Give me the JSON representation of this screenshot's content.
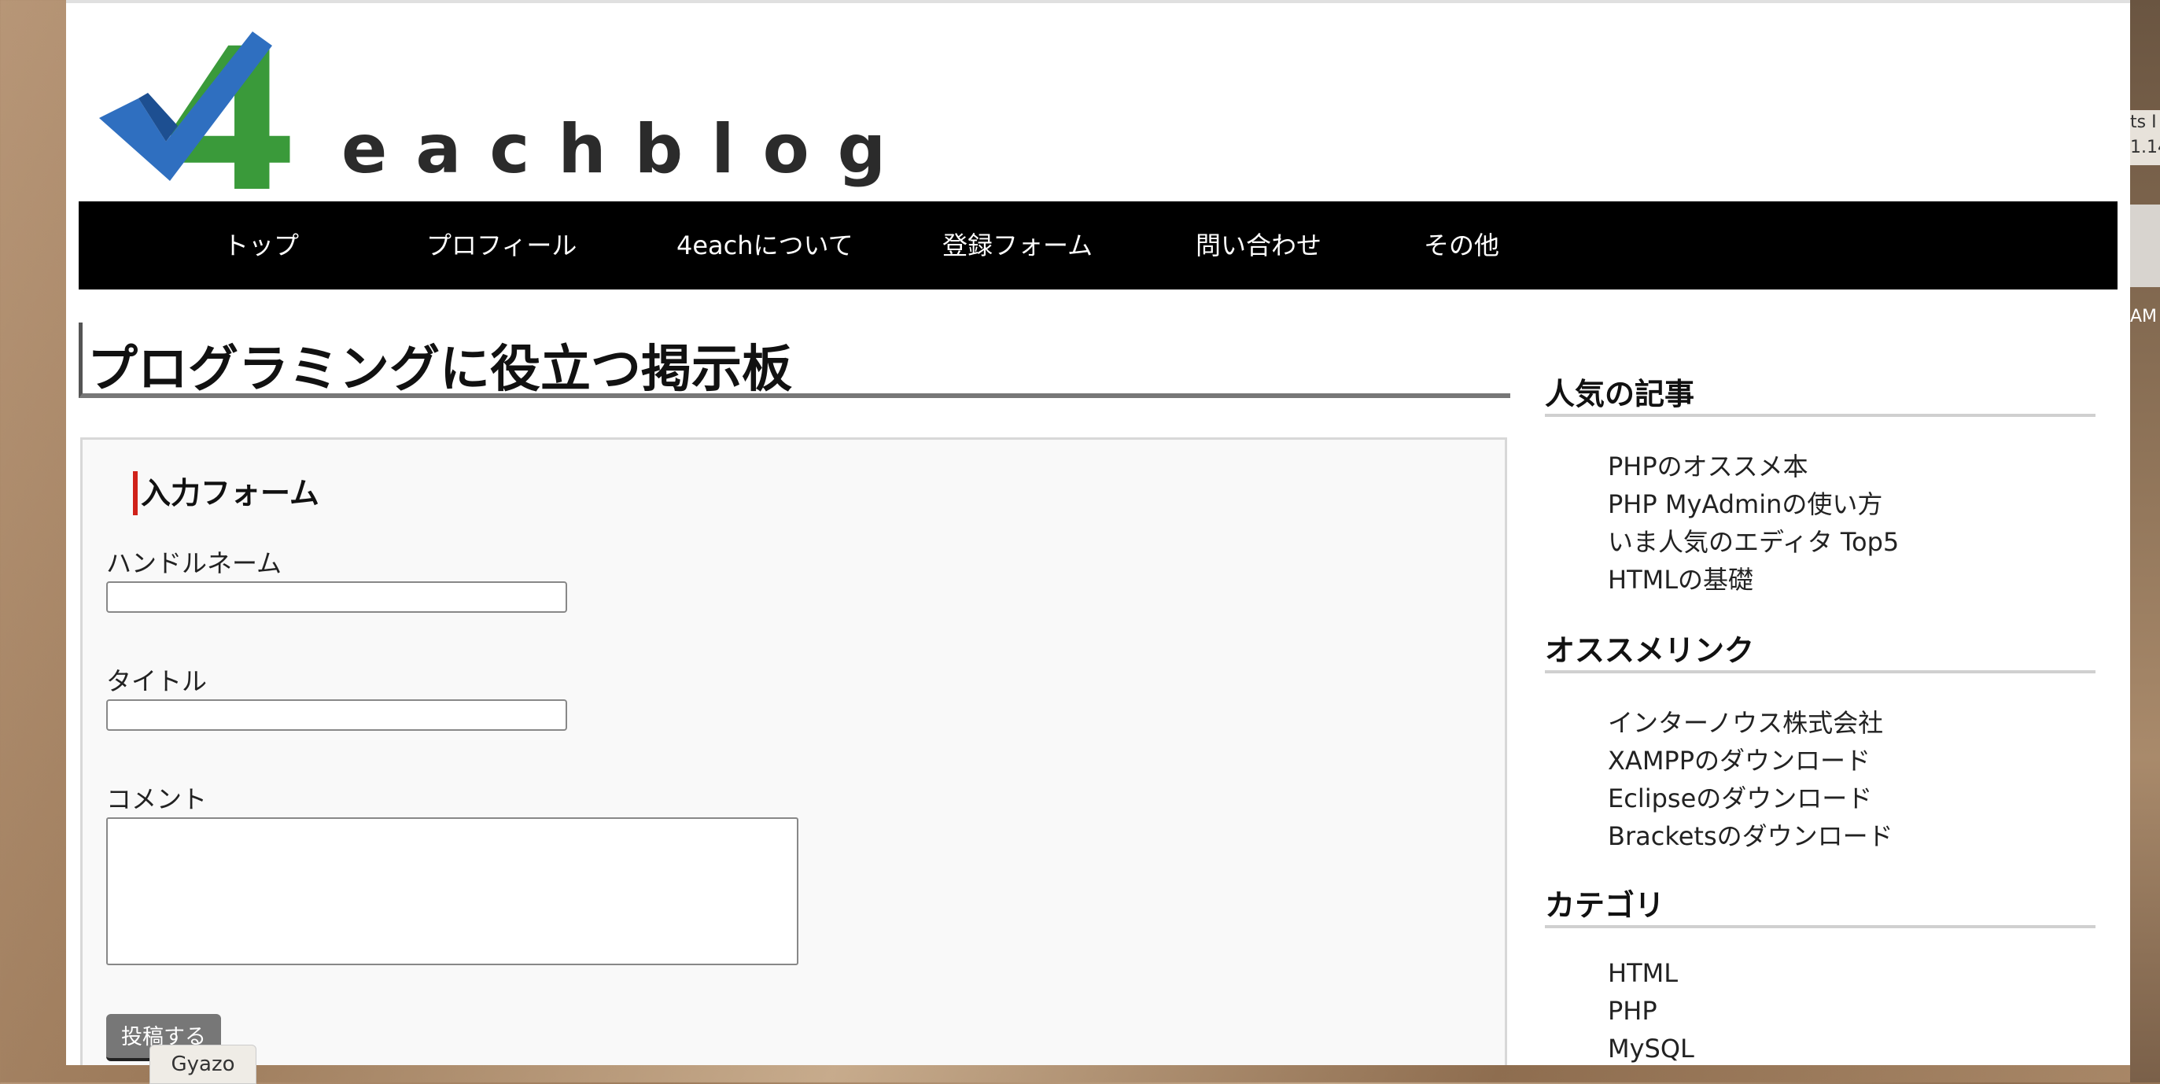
{
  "site": {
    "logo_text": "eachblog",
    "logo_mark": "4",
    "brand_colors": {
      "blue": "#2f6fc0",
      "green": "#3a9a3a",
      "dark": "#2b2b2b"
    }
  },
  "nav": {
    "items": [
      {
        "label": "トップ"
      },
      {
        "label": "プロフィール"
      },
      {
        "label": "4eachについて"
      },
      {
        "label": "登録フォーム"
      },
      {
        "label": "問い合わせ"
      },
      {
        "label": "その他"
      }
    ]
  },
  "main": {
    "title": "プログラミングに役立つ掲示板",
    "form": {
      "heading": "入力フォーム",
      "fields": [
        {
          "label": "ハンドルネーム",
          "value": "",
          "placeholder": ""
        },
        {
          "label": "タイトル",
          "value": "",
          "placeholder": ""
        },
        {
          "label": "コメント",
          "value": "",
          "placeholder": ""
        }
      ],
      "submit_label": "投稿する"
    }
  },
  "sidebar": {
    "sections": [
      {
        "heading": "人気の記事",
        "items": [
          "PHPのオススメ本",
          "PHP MyAdminの使い方",
          "いま人気のエディタ Top5",
          "HTMLの基礎"
        ]
      },
      {
        "heading": "オススメリンク",
        "items": [
          "インターノウス株式会社",
          "XAMPPのダウンロード",
          "Eclipseのダウンロード",
          "Bracketsのダウンロード"
        ]
      },
      {
        "heading": "カテゴリ",
        "items": [
          "HTML",
          "PHP",
          "MySQL"
        ]
      }
    ]
  },
  "overlay": {
    "gyazo_label": "Gyazo"
  },
  "background": {
    "window_text": [
      "ts I",
      "1.14",
      "AM"
    ]
  }
}
